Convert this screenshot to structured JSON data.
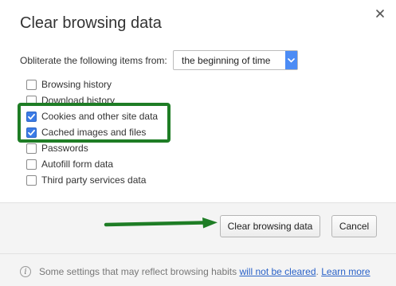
{
  "dialog": {
    "title": "Clear browsing data"
  },
  "range": {
    "label": "Obliterate the following items from:",
    "selected": "the beginning of time"
  },
  "items": [
    {
      "label": "Browsing history",
      "checked": false
    },
    {
      "label": "Download history",
      "checked": false
    },
    {
      "label": "Cookies and other site data",
      "checked": true
    },
    {
      "label": "Cached images and files",
      "checked": true
    },
    {
      "label": "Passwords",
      "checked": false
    },
    {
      "label": "Autofill form data",
      "checked": false
    },
    {
      "label": "Third party services data",
      "checked": false
    }
  ],
  "buttons": {
    "clear": "Clear browsing data",
    "cancel": "Cancel"
  },
  "footer": {
    "text": "Some settings that may reflect browsing habits",
    "link1": "will not be cleared",
    "sep": ".",
    "link2": "Learn more"
  },
  "colors": {
    "checkbox_checked": "#3b7be6",
    "highlight": "#1e7d25",
    "select_button": "#4c8cf5",
    "link": "#2a62c8"
  },
  "icons": {
    "close": "close-icon",
    "dropdown": "chevron-down-icon",
    "info": "info-icon",
    "check": "check-icon",
    "arrow": "arrow-right-icon"
  }
}
